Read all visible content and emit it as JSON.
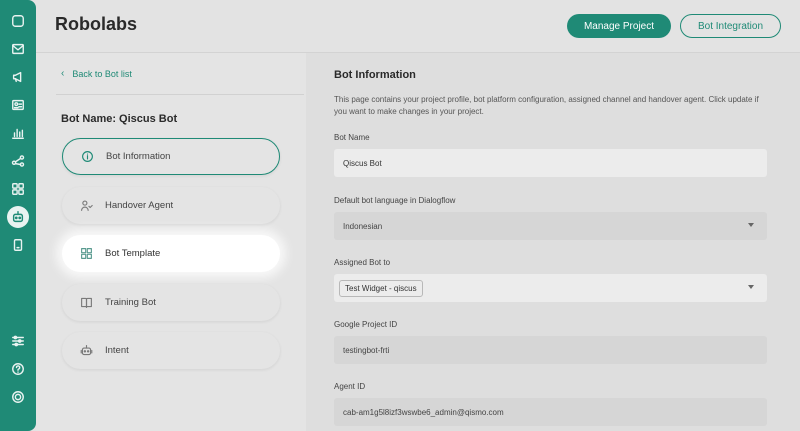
{
  "app": {
    "title": "Robolabs"
  },
  "header": {
    "manage_project_label": "Manage Project",
    "bot_integration_label": "Bot Integration"
  },
  "sidebar": {
    "icons": [
      "chat-icon",
      "inbox-icon",
      "broadcast-icon",
      "contacts-icon",
      "analytics-icon",
      "integration-icon",
      "apps-icon",
      "bot-icon",
      "mobile-icon",
      "settings-icon",
      "help-icon",
      "profile-icon"
    ],
    "active": "bot-icon"
  },
  "left": {
    "back_label": "Back to Bot list",
    "bot_name_label": "Bot Name: Qiscus Bot",
    "menu": [
      {
        "label": "Bot Information",
        "icon": "info-icon",
        "state": "selected"
      },
      {
        "label": "Handover Agent",
        "icon": "agent-icon",
        "state": "normal"
      },
      {
        "label": "Bot Template",
        "icon": "template-grid-icon",
        "state": "highlighted"
      },
      {
        "label": "Training Bot",
        "icon": "book-icon",
        "state": "normal"
      },
      {
        "label": "Intent",
        "icon": "robot-icon",
        "state": "normal"
      }
    ]
  },
  "info": {
    "title": "Bot Information",
    "description": "This page contains your project profile, bot platform configuration, assigned channel and handover agent. Click update if you want to make changes in your project.",
    "fields": {
      "bot_name": {
        "label": "Bot Name",
        "value": "Qiscus Bot"
      },
      "language": {
        "label": "Default bot language in Dialogflow",
        "value": "Indonesian"
      },
      "assigned": {
        "label": "Assigned Bot to",
        "value": "Test Widget - qiscus"
      },
      "project_id": {
        "label": "Google Project ID",
        "value": "testingbot-frti"
      },
      "agent_id": {
        "label": "Agent ID",
        "value": "cab-am1g5l8izf3wswbe6_admin@qismo.com"
      }
    }
  },
  "colors": {
    "primary": "#1f8a76",
    "background": "#e3e3e3",
    "highlight": "#ffffff"
  }
}
